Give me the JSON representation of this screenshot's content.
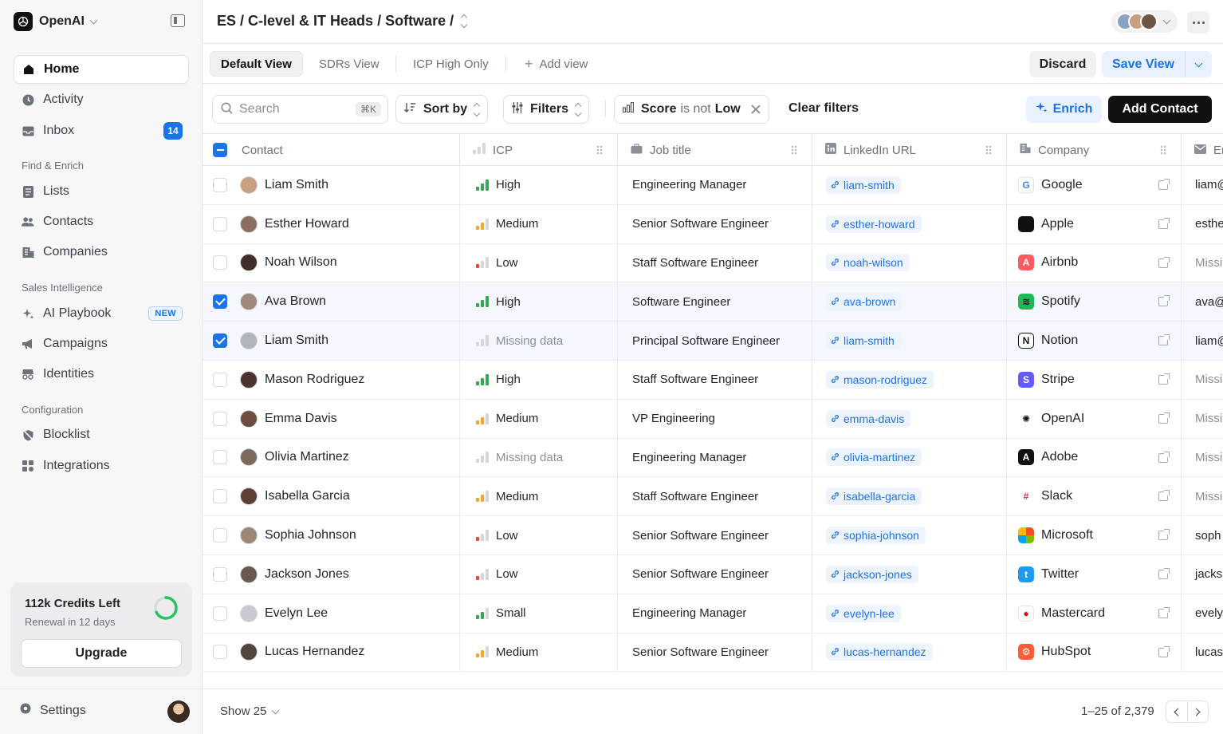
{
  "workspace": {
    "name": "OpenAI"
  },
  "nav": {
    "home": "Home",
    "activity": "Activity",
    "inbox": "Inbox",
    "inbox_count": "14",
    "find_enrich_title": "Find & Enrich",
    "lists": "Lists",
    "contacts": "Contacts",
    "companies": "Companies",
    "sales_intel_title": "Sales Intelligence",
    "ai_playbook": "AI Playbook",
    "new_badge": "NEW",
    "campaigns": "Campaigns",
    "identities": "Identities",
    "config_title": "Configuration",
    "blocklist": "Blocklist",
    "integrations": "Integrations"
  },
  "credits": {
    "title": "112k Credits Left",
    "renewal": "Renewal in 12 days",
    "upgrade": "Upgrade",
    "used_fraction": 0.68
  },
  "settings": "Settings",
  "breadcrumb": "ES / C-level & IT Heads / Software /",
  "views": {
    "tabs": [
      "Default View",
      "SDRs View",
      "ICP High Only"
    ],
    "add_view": "Add view",
    "discard": "Discard",
    "save": "Save View"
  },
  "filters": {
    "search_placeholder": "Search",
    "search_kbd": "⌘K",
    "sort_by": "Sort by",
    "filters": "Filters",
    "score_label": "Score",
    "score_op": "is not",
    "score_value": "Low",
    "clear": "Clear filters",
    "enrich": "Enrich",
    "add_contact": "Add Contact"
  },
  "columns": [
    "Contact",
    "ICP",
    "Job title",
    "LinkedIn URL",
    "Company",
    "Em"
  ],
  "colors": {
    "accent": "#1a73e8",
    "icp_high": "#34a853",
    "icp_medium": "#f5a623",
    "icp_low": "#ea4335"
  },
  "rows": [
    {
      "name": "Liam Smith",
      "icp": "High",
      "title": "Engineering Manager",
      "linkedin": "liam-smith",
      "company": "Google",
      "email": "liam@",
      "checked": false
    },
    {
      "name": "Esther Howard",
      "icp": "Medium",
      "title": "Senior Software Engineer",
      "linkedin": "esther-howard",
      "company": "Apple",
      "email": "esthe",
      "checked": false
    },
    {
      "name": "Noah Wilson",
      "icp": "Low",
      "title": "Staff Software Engineer",
      "linkedin": "noah-wilson",
      "company": "Airbnb",
      "email": "Missi",
      "checked": false
    },
    {
      "name": "Ava Brown",
      "icp": "High",
      "title": "Software Engineer",
      "linkedin": "ava-brown",
      "company": "Spotify",
      "email": "ava@",
      "checked": true
    },
    {
      "name": "Liam Smith",
      "icp": "Missing data",
      "title": "Principal Software Engineer",
      "linkedin": "liam-smith",
      "company": "Notion",
      "email": "liam@",
      "checked": true
    },
    {
      "name": "Mason Rodriguez",
      "icp": "High",
      "title": "Staff Software Engineer",
      "linkedin": "mason-rodriguez",
      "company": "Stripe",
      "email": "Missi",
      "checked": false
    },
    {
      "name": "Emma Davis",
      "icp": "Medium",
      "title": "VP Engineering",
      "linkedin": "emma-davis",
      "company": "OpenAI",
      "email": "Missi",
      "checked": false
    },
    {
      "name": "Olivia Martinez",
      "icp": "Missing data",
      "title": "Engineering Manager",
      "linkedin": "olivia-martinez",
      "company": "Adobe",
      "email": "Missi",
      "checked": false
    },
    {
      "name": "Isabella Garcia",
      "icp": "Medium",
      "title": "Staff Software Engineer",
      "linkedin": "isabella-garcia",
      "company": "Slack",
      "email": "Missi",
      "checked": false
    },
    {
      "name": "Sophia Johnson",
      "icp": "Low",
      "title": "Senior Software Engineer",
      "linkedin": "sophia-johnson",
      "company": "Microsoft",
      "email": "soph",
      "checked": false
    },
    {
      "name": "Jackson Jones",
      "icp": "Low",
      "title": "Senior Software Engineer",
      "linkedin": "jackson-jones",
      "company": "Twitter",
      "email": "jacks",
      "checked": false
    },
    {
      "name": "Evelyn Lee",
      "icp": "Small",
      "title": "Engineering Manager",
      "linkedin": "evelyn-lee",
      "company": "Mastercard",
      "email": "evely",
      "checked": false
    },
    {
      "name": "Lucas Hernandez",
      "icp": "Medium",
      "title": "Senior Software Engineer",
      "linkedin": "lucas-hernandez",
      "company": "HubSpot",
      "email": "lucas",
      "checked": false
    }
  ],
  "footer": {
    "show": "Show 25",
    "range": "1–25 of 2,379"
  }
}
